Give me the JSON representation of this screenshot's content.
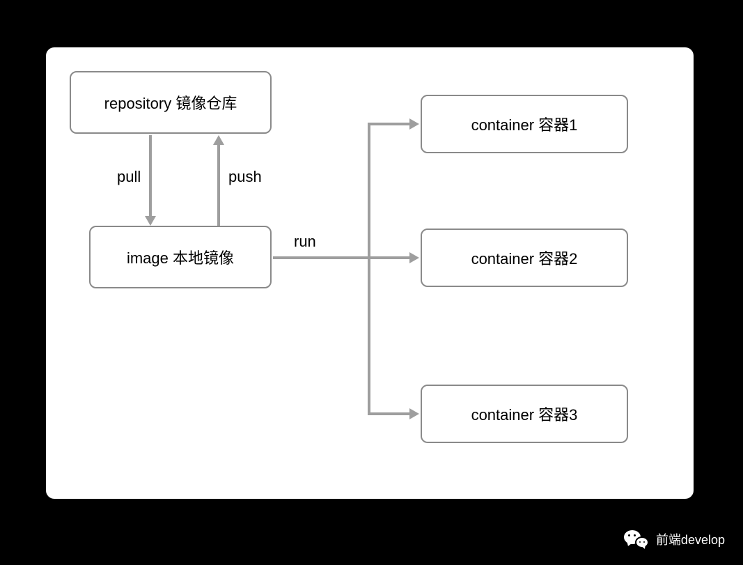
{
  "diagram": {
    "repository": "repository 镜像仓库",
    "image": "image 本地镜像",
    "container1": "container 容器1",
    "container2": "container 容器2",
    "container3": "container 容器3",
    "labels": {
      "pull": "pull",
      "push": "push",
      "run": "run"
    }
  },
  "watermark": {
    "text": "前端develop"
  }
}
